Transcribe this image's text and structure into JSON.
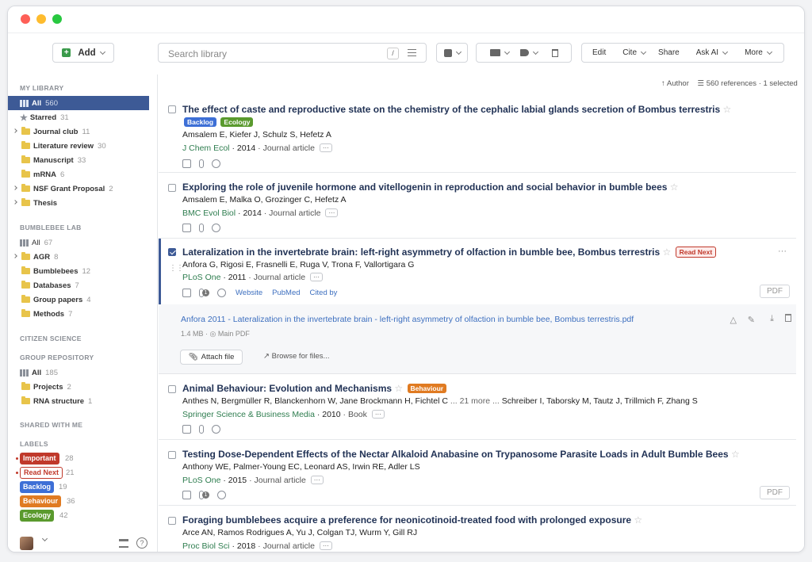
{
  "toolbar": {
    "add": "Add",
    "search_placeholder": "Search library",
    "search_shortcut": "/",
    "edit": "Edit",
    "cite": "Cite",
    "share": "Share",
    "ask_ai": "Ask AI",
    "more": "More"
  },
  "sort": {
    "label": "Author",
    "refs": "560 references · 1 selected"
  },
  "sidebar": {
    "my_library": "MY LIBRARY",
    "items": [
      {
        "label": "All",
        "count": "560"
      },
      {
        "label": "Starred",
        "count": "31"
      },
      {
        "label": "Journal club",
        "count": "11"
      },
      {
        "label": "Literature review",
        "count": "30"
      },
      {
        "label": "Manuscript",
        "count": "33"
      },
      {
        "label": "mRNA",
        "count": "6"
      },
      {
        "label": "NSF Grant Proposal",
        "count": "2"
      },
      {
        "label": "Thesis",
        "count": ""
      }
    ],
    "bumblebee": "BUMBLEBEE LAB",
    "bee_items": [
      {
        "label": "All",
        "count": "67"
      },
      {
        "label": "AGR",
        "count": "8"
      },
      {
        "label": "Bumblebees",
        "count": "12"
      },
      {
        "label": "Databases",
        "count": "7"
      },
      {
        "label": "Group papers",
        "count": "4"
      },
      {
        "label": "Methods",
        "count": "7"
      }
    ],
    "citizen": "CITIZEN SCIENCE",
    "group_repo": "GROUP REPOSITORY",
    "repo_items": [
      {
        "label": "All",
        "count": "185"
      },
      {
        "label": "Projects",
        "count": "2"
      },
      {
        "label": "RNA structure",
        "count": "1"
      }
    ],
    "shared": "SHARED WITH ME",
    "labels_head": "LABELS",
    "labels": [
      {
        "label": "Important",
        "count": "28",
        "color": "#c0392b"
      },
      {
        "label": "Read Next",
        "count": "21",
        "color": "#c0392b"
      },
      {
        "label": "Backlog",
        "count": "19",
        "color": "#3d6fd6"
      },
      {
        "label": "Behaviour",
        "count": "36",
        "color": "#e07b22"
      },
      {
        "label": "Ecology",
        "count": "42",
        "color": "#5a9a2e"
      }
    ]
  },
  "refs": [
    {
      "title": "The effect of caste and reproductive state on the chemistry of the cephalic labial glands secretion of Bombus terrestris",
      "tags": [
        "Backlog",
        "Ecology"
      ],
      "authors": "Amsalem E, Kiefer J, Schulz S, Hefetz A",
      "journal": "J Chem Ecol",
      "year": "· 2014",
      "type": "· Journal article"
    },
    {
      "title": "Exploring the role of juvenile hormone and vitellogenin in reproduction and social behavior in bumble bees",
      "authors": "Amsalem E, Malka O, Grozinger C, Hefetz A",
      "journal": "BMC Evol Biol",
      "year": "· 2014",
      "type": "· Journal article"
    },
    {
      "title": "Lateralization in the invertebrate brain: left-right asymmetry of olfaction in bumble bee, Bombus terrestris",
      "tag": "Read Next",
      "authors": "Anfora G, Rigosi E, Frasnelli E, Ruga V, Trona F, Vallortigara G",
      "journal": "PLoS One",
      "year": "· 2011",
      "type": "· Journal article",
      "links": [
        "Website",
        "PubMed",
        "Cited by"
      ],
      "pdf": "PDF",
      "clip_count": "1"
    },
    {
      "title": "Animal Behaviour: Evolution and Mechanisms",
      "tag": "Behaviour",
      "authors": "Anthes N, Bergmüller R, Blanckenhorn W, Jane Brockmann H, Fichtel C",
      "more": "... 21 more ...",
      "authors2": "Schreiber I, Taborsky M, Tautz J, Trillmich F, Zhang S",
      "journal": "Springer Science & Business Media",
      "year": "· 2010",
      "type": "· Book"
    },
    {
      "title": "Testing Dose-Dependent Effects of the Nectar Alkaloid Anabasine on Trypanosome Parasite Loads in Adult Bumble Bees",
      "authors": "Anthony WE, Palmer-Young EC, Leonard AS, Irwin RE, Adler LS",
      "journal": "PLoS One",
      "year": "· 2015",
      "type": "· Journal article",
      "pdf": "PDF",
      "clip_count": "1"
    },
    {
      "title": "Foraging bumblebees acquire a preference for neonicotinoid-treated food with prolonged exposure",
      "authors": "Arce AN, Ramos Rodrigues A, Yu J, Colgan TJ, Wurm Y, Gill RJ",
      "journal": "Proc Biol Sci",
      "year": "· 2018",
      "type": "· Journal article"
    }
  ],
  "attachment": {
    "file": "Anfora 2011 - Lateralization in the invertebrate brain - left-right asymmetry of olfaction in bumble bee, Bombus terrestris.pdf",
    "size": "1.4 MB ·",
    "main": "Main PDF",
    "attach": "Attach file",
    "browse": "Browse for files..."
  },
  "ellipsis": "···",
  "more_dots": "···",
  "tag_colors": {
    "Backlog": "#3d6fd6",
    "Ecology": "#5a9a2e",
    "Read Next": "#c0392b",
    "Behaviour": "#e07b22"
  }
}
